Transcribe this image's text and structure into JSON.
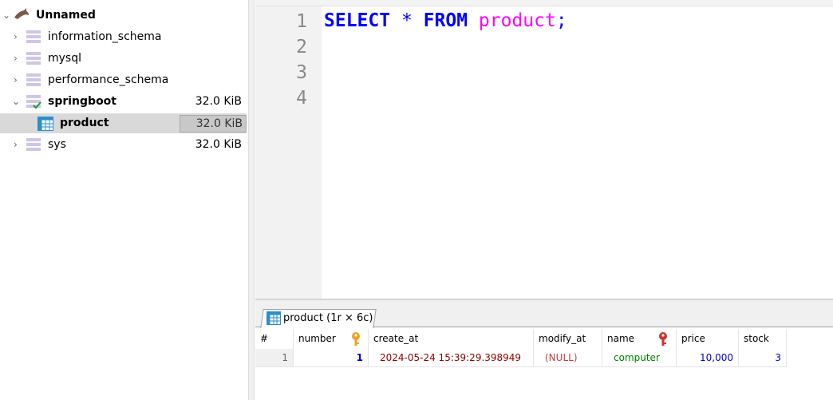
{
  "tree": {
    "root": {
      "label": "Unnamed"
    },
    "databases": [
      {
        "label": "information_schema",
        "size": ""
      },
      {
        "label": "mysql",
        "size": ""
      },
      {
        "label": "performance_schema",
        "size": ""
      },
      {
        "label": "springboot",
        "size": "32.0 KiB"
      },
      {
        "label": "sys",
        "size": "32.0 KiB"
      }
    ],
    "table": {
      "label": "product",
      "size": "32.0 KiB"
    }
  },
  "editor": {
    "line_numbers": [
      "1",
      "2",
      "3",
      "4"
    ],
    "query": {
      "kw1": "SELECT",
      "star": "*",
      "kw2": "FROM",
      "table": "product",
      "semi": ";"
    }
  },
  "results": {
    "tab_label": "product (1r × 6c)",
    "columns": [
      "#",
      "number",
      "create_at",
      "modify_at",
      "name",
      "price",
      "stock"
    ],
    "rows": [
      {
        "rownum": "1",
        "number": "1",
        "create_at": "2024-05-24 15:39:29.398949",
        "modify_at": "(NULL)",
        "name": "computer",
        "price": "10,000",
        "stock": "3"
      }
    ]
  },
  "colors": {
    "keyword": "#0000ff",
    "identifier": "#ff00ff",
    "number_value": "#0000cc",
    "date_value": "#8b0000",
    "null_value": "#c04040",
    "text_value": "#008000",
    "primary_key": "#f0a020",
    "unique_key": "#d03030"
  }
}
